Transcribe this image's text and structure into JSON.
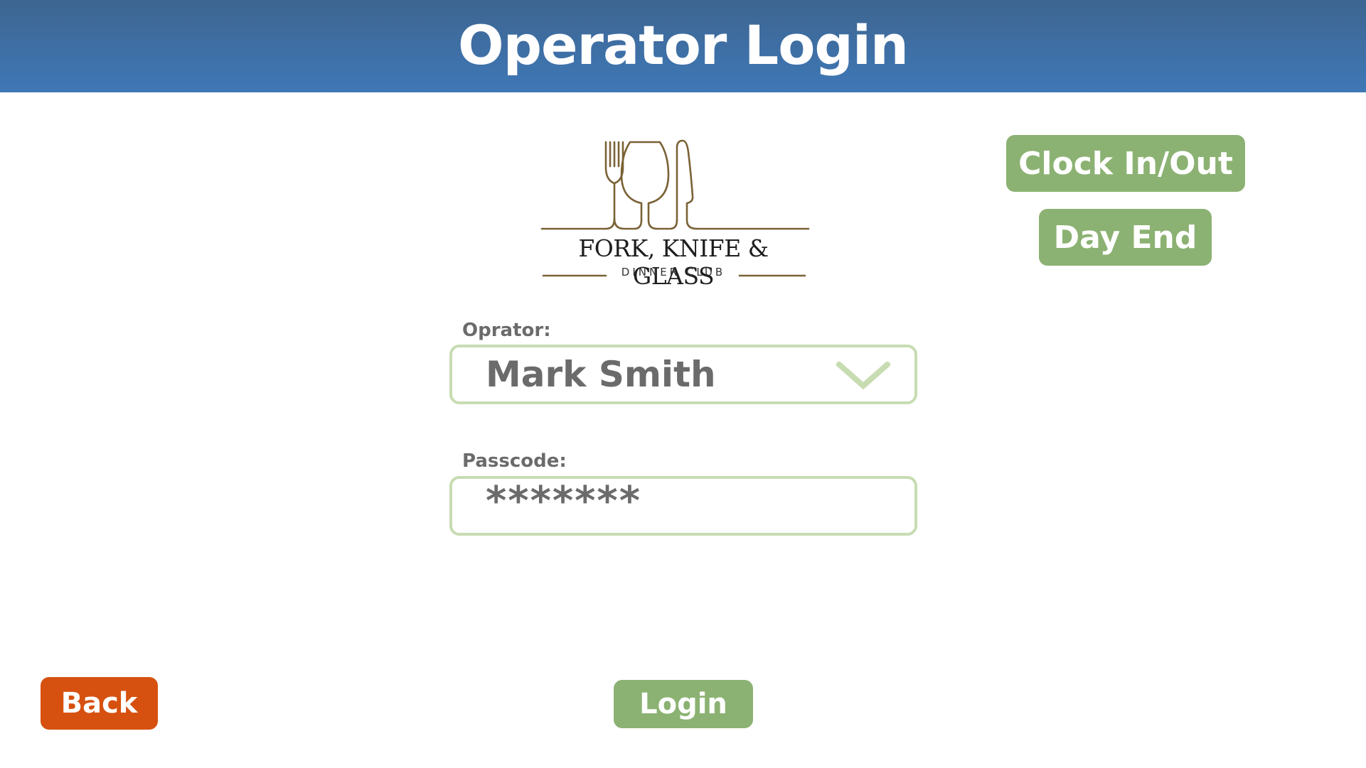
{
  "header": {
    "title": "Operator Login"
  },
  "logo": {
    "name": "FORK, KNIFE & GLASS",
    "tagline": "DINNER CLUB",
    "color": "#7a6236"
  },
  "actions": {
    "clock_in_out": "Clock In/Out",
    "day_end": "Day End",
    "login": "Login",
    "back": "Back"
  },
  "form": {
    "operator_label": "Oprator:",
    "operator_value": "Mark Smith",
    "passcode_label": "Passcode:",
    "passcode_value": "*******"
  },
  "icons": {
    "dropdown": "chevron-down-icon"
  },
  "colors": {
    "header_top": "#3d6591",
    "header_bottom": "#3f78b6",
    "green_button": "#8cb273",
    "back_button": "#d6510f",
    "field_border": "#c8dcb2"
  }
}
